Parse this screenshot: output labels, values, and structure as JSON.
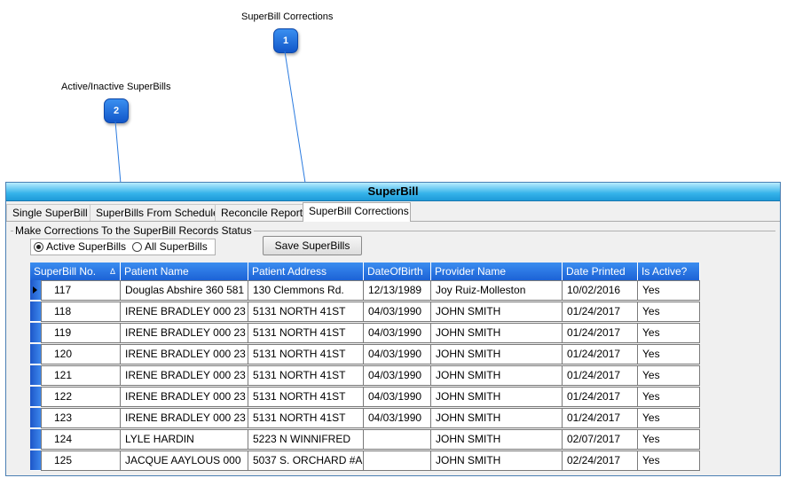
{
  "callouts": [
    {
      "number": "1",
      "label": "SuperBill Corrections"
    },
    {
      "number": "2",
      "label": "Active/Inactive SuperBills"
    }
  ],
  "window": {
    "title": "SuperBill"
  },
  "tabs": [
    {
      "label": "Single SuperBill"
    },
    {
      "label": "SuperBills From Schedule"
    },
    {
      "label": "Reconcile Report"
    },
    {
      "label": "SuperBill Corrections",
      "active": true
    }
  ],
  "group": {
    "title": "Make Corrections To the SuperBill Records Status"
  },
  "filter": {
    "active_label": "Active SuperBills",
    "all_label": "All SuperBills",
    "selected": "Active SuperBills"
  },
  "save_button": {
    "label": "Save SuperBills"
  },
  "table": {
    "columns": [
      "SuperBill No.",
      "Patient Name",
      "Patient Address",
      "DateOfBirth",
      "Provider Name",
      "Date Printed",
      "Is Active?"
    ],
    "sort_indicator": "Δ",
    "rows": [
      [
        "117",
        "Douglas Abshire  360 581",
        "130 Clemmons Rd.",
        "12/13/1989",
        "Joy Ruiz-Molleston",
        "10/02/2016",
        "Yes"
      ],
      [
        "118",
        "IRENE BRADLEY  000 23",
        "5131 NORTH 41ST",
        "04/03/1990",
        "JOHN SMITH",
        "01/24/2017",
        "Yes"
      ],
      [
        "119",
        "IRENE BRADLEY  000 23",
        "5131 NORTH 41ST",
        "04/03/1990",
        "JOHN SMITH",
        "01/24/2017",
        "Yes"
      ],
      [
        "120",
        "IRENE BRADLEY  000 23",
        "5131 NORTH 41ST",
        "04/03/1990",
        "JOHN SMITH",
        "01/24/2017",
        "Yes"
      ],
      [
        "121",
        "IRENE BRADLEY  000 23",
        "5131 NORTH 41ST",
        "04/03/1990",
        "JOHN SMITH",
        "01/24/2017",
        "Yes"
      ],
      [
        "122",
        "IRENE BRADLEY  000 23",
        "5131 NORTH 41ST",
        "04/03/1990",
        "JOHN SMITH",
        "01/24/2017",
        "Yes"
      ],
      [
        "123",
        "IRENE BRADLEY  000 23",
        "5131 NORTH 41ST",
        "04/03/1990",
        "JOHN SMITH",
        "01/24/2017",
        "Yes"
      ],
      [
        "124",
        "LYLE HARDIN",
        "5223 N WINNIFRED",
        "",
        "JOHN SMITH",
        "02/07/2017",
        "Yes"
      ],
      [
        "125",
        "JACQUE AAYLOUS  000",
        "5037 S. ORCHARD #A",
        "",
        "JOHN SMITH",
        "02/24/2017",
        "Yes"
      ]
    ]
  },
  "colors": {
    "accent": "#1c62d6",
    "titlebar": "#35b3ea",
    "callout": "#1f6fe0"
  }
}
